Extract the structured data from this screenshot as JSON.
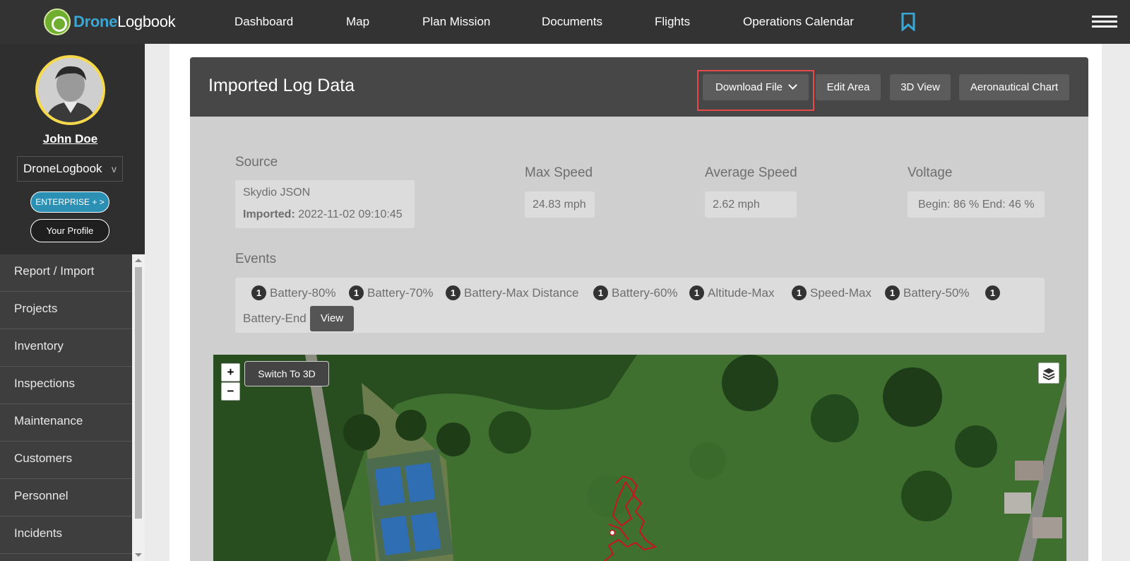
{
  "app": {
    "logo_brand": "Drone",
    "logo_rest": "Logbook"
  },
  "nav": {
    "items": [
      "Dashboard",
      "Map",
      "Plan Mission",
      "Documents",
      "Flights",
      "Operations Calendar"
    ],
    "bookmark_icon": "bookmark-icon",
    "menu_icon": "hamburger-icon"
  },
  "sidebar": {
    "user_name": "John Doe",
    "company": "DroneLogbook",
    "company_chevron": "v",
    "enterprise_label": "ENTERPRISE + >",
    "profile_label": "Your Profile",
    "menu": [
      "Report / Import",
      "Projects",
      "Inventory",
      "Inspections",
      "Maintenance",
      "Customers",
      "Personnel",
      "Incidents"
    ]
  },
  "panel": {
    "title": "Imported Log Data",
    "buttons": {
      "download": "Download File",
      "edit_area": "Edit Area",
      "view_3d": "3D View",
      "aero_chart": "Aeronautical Chart"
    }
  },
  "source": {
    "label": "Source",
    "value": "Skydio JSON",
    "imported_label": "Imported:",
    "imported_value": "2022-11-02 09:10:45"
  },
  "stats": {
    "max_speed_label": "Max Speed",
    "max_speed_value": "24.83 mph",
    "avg_speed_label": "Average Speed",
    "avg_speed_value": "2.62 mph",
    "voltage_label": "Voltage",
    "voltage_value": "Begin: 86 % End: 46 %"
  },
  "events": {
    "label": "Events",
    "items": [
      {
        "count": "1",
        "name": "Battery-80%"
      },
      {
        "count": "1",
        "name": "Battery-70%"
      },
      {
        "count": "1",
        "name": "Battery-Max Distance"
      },
      {
        "count": "1",
        "name": "Battery-60%"
      },
      {
        "count": "1",
        "name": "Altitude-Max"
      },
      {
        "count": "1",
        "name": "Speed-Max"
      },
      {
        "count": "1",
        "name": "Battery-50%"
      },
      {
        "count": "1",
        "name": "Battery-End"
      }
    ],
    "view_label": "View"
  },
  "map": {
    "zoom_in": "+",
    "zoom_out": "−",
    "switch_label": "Switch To 3D",
    "layers_icon": "layers-icon",
    "track_color": "#c8141e"
  },
  "colors": {
    "topbar": "#333333",
    "accent_blue": "#39a8d6",
    "enterprise": "#2c8fb4",
    "highlight": "#e44a4a"
  }
}
